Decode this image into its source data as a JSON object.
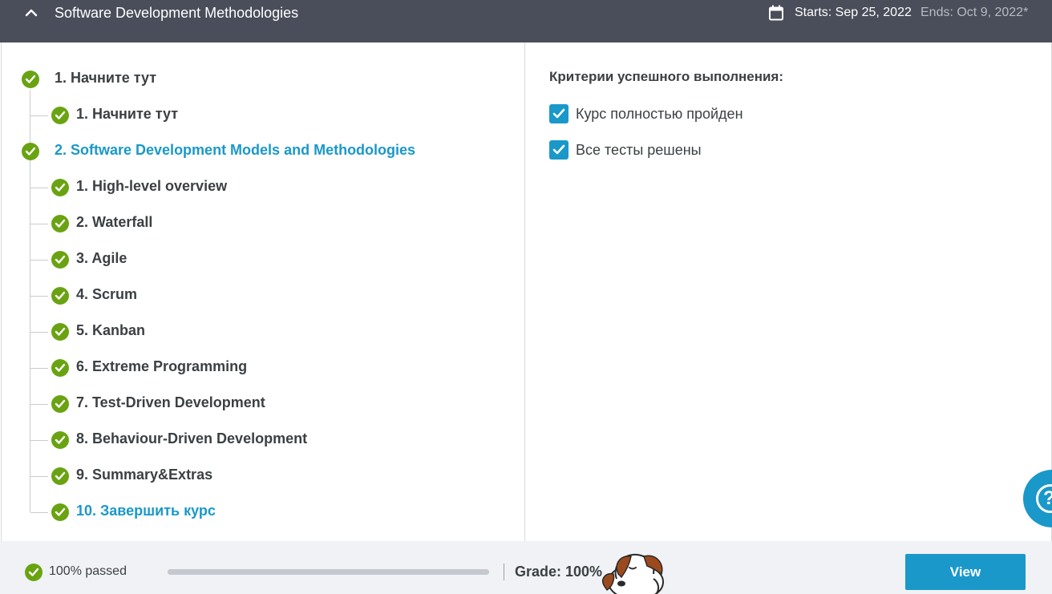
{
  "header": {
    "title": "Software Development Methodologies",
    "starts": "Starts: Sep 25, 2022",
    "ends": "Ends: Oct 9, 2022*"
  },
  "outline": [
    {
      "label": "1. Начните тут",
      "level": 0,
      "active": false
    },
    {
      "label": "1. Начните тут",
      "level": 1,
      "active": false
    },
    {
      "label": "2. Software Development Models and Methodologies",
      "level": 0,
      "active": true
    },
    {
      "label": "1. High-level overview",
      "level": 1,
      "active": false
    },
    {
      "label": "2. Waterfall",
      "level": 1,
      "active": false
    },
    {
      "label": "3. Agile",
      "level": 1,
      "active": false
    },
    {
      "label": "4. Scrum",
      "level": 1,
      "active": false
    },
    {
      "label": "5. Kanban",
      "level": 1,
      "active": false
    },
    {
      "label": "6. Extreme Programming",
      "level": 1,
      "active": false
    },
    {
      "label": "7. Test-Driven Development",
      "level": 1,
      "active": false
    },
    {
      "label": "8. Behaviour-Driven Development",
      "level": 1,
      "active": false
    },
    {
      "label": "9. Summary&Extras",
      "level": 1,
      "active": false
    },
    {
      "label": "10. Завершить курс",
      "level": 1,
      "active": true
    }
  ],
  "criteria": {
    "title": "Критерии успешного выполнения:",
    "items": [
      {
        "label": "Курс полностью пройден",
        "checked": true
      },
      {
        "label": "Все тесты решены",
        "checked": true
      }
    ]
  },
  "footer": {
    "passed": "100% passed",
    "progress_fraction": 1.0,
    "grade": "Grade: 100%",
    "view_label": "View"
  },
  "help": {
    "icon": "question-mark-icon",
    "glyph": "?"
  },
  "colors": {
    "header_bg": "#4a4e5a",
    "accent": "#1a98c9",
    "success": "#6aa312"
  }
}
